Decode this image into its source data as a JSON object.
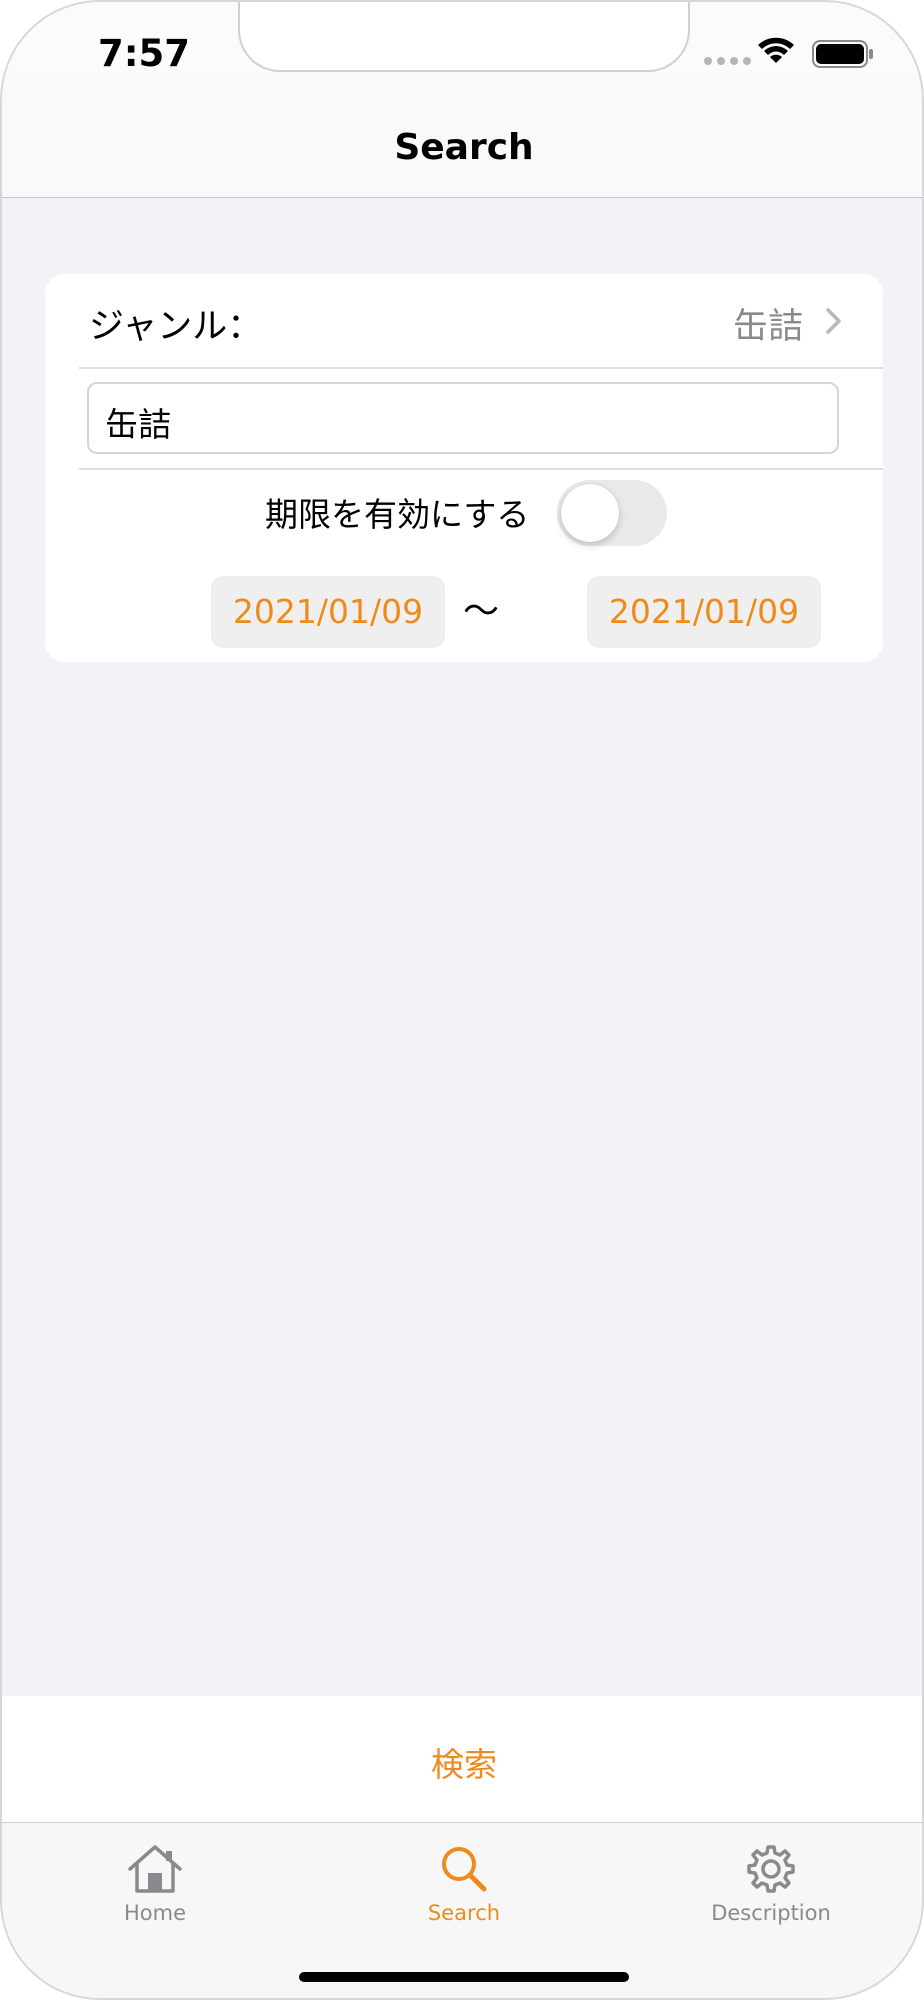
{
  "status_bar": {
    "time": "7:57"
  },
  "nav": {
    "title": "Search"
  },
  "form": {
    "genre_label": "ジャンル：",
    "genre_value": "缶詰",
    "text_field_value": "缶詰",
    "toggle_label": "期限を有効にする",
    "toggle_on": false,
    "date_from": "2021/01/09",
    "date_separator": "〜",
    "date_to": "2021/01/09"
  },
  "search_action": {
    "label": "検索"
  },
  "tabs": [
    {
      "label": "Home",
      "icon": "house-icon",
      "selected": false
    },
    {
      "label": "Search",
      "icon": "magnifyingglass-icon",
      "selected": true
    },
    {
      "label": "Description",
      "icon": "gear-icon",
      "selected": false
    }
  ],
  "colors": {
    "accent": "#ee8b1c",
    "inactive_tab": "#8a8a8e",
    "background": "#f2f2f7",
    "card": "#ffffff"
  }
}
